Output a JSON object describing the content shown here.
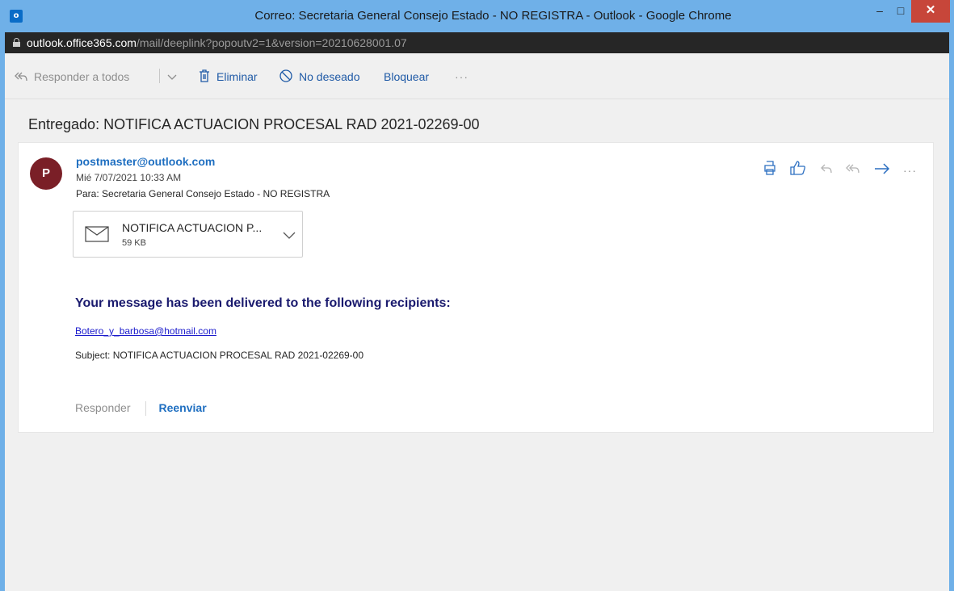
{
  "window": {
    "title": "Correo: Secretaria General Consejo Estado - NO REGISTRA - Outlook - Google Chrome",
    "app_icon_letter": "o",
    "minimize_glyph": "–",
    "maximize_glyph": "□",
    "close_glyph": "✕"
  },
  "address_bar": {
    "host": "outlook.office365.com",
    "path": "/mail/deeplink?popoutv2=1&version=20210628001.07"
  },
  "toolbar": {
    "reply_all": "Responder a todos",
    "delete": "Eliminar",
    "junk": "No deseado",
    "block": "Bloquear",
    "more": "···"
  },
  "message": {
    "subject": "Entregado: NOTIFICA ACTUACION PROCESAL RAD 2021-02269-00",
    "avatar_letter": "P",
    "sender": "postmaster@outlook.com",
    "date": "Mié 7/07/2021 10:33 AM",
    "to_label": "Para:",
    "to_value": "Secretaria General Consejo Estado - NO REGISTRA",
    "attachment": {
      "name": "NOTIFICA ACTUACION P...",
      "size": "59 KB"
    },
    "body": {
      "heading": "Your message has been delivered to the following recipients:",
      "recipient": "Botero_y_barbosa@hotmail.com",
      "subject_line": "Subject: NOTIFICA ACTUACION PROCESAL RAD 2021-02269-00"
    },
    "reply": "Responder",
    "forward": "Reenviar"
  },
  "colors": {
    "chrome_frame": "#6fb0e8",
    "address_bar_bg": "#262626",
    "link_blue": "#1f6fc1",
    "avatar_bg": "#7a1f27",
    "close_button": "#c7463a",
    "body_heading": "#1a1a6e"
  },
  "icons": [
    "outlook-app-icon",
    "lock-icon",
    "reply-all-icon",
    "chevron-down-icon",
    "trash-icon",
    "block-icon",
    "print-icon",
    "like-icon",
    "reply-icon",
    "forward-icon",
    "more-icon",
    "envelope-icon"
  ]
}
